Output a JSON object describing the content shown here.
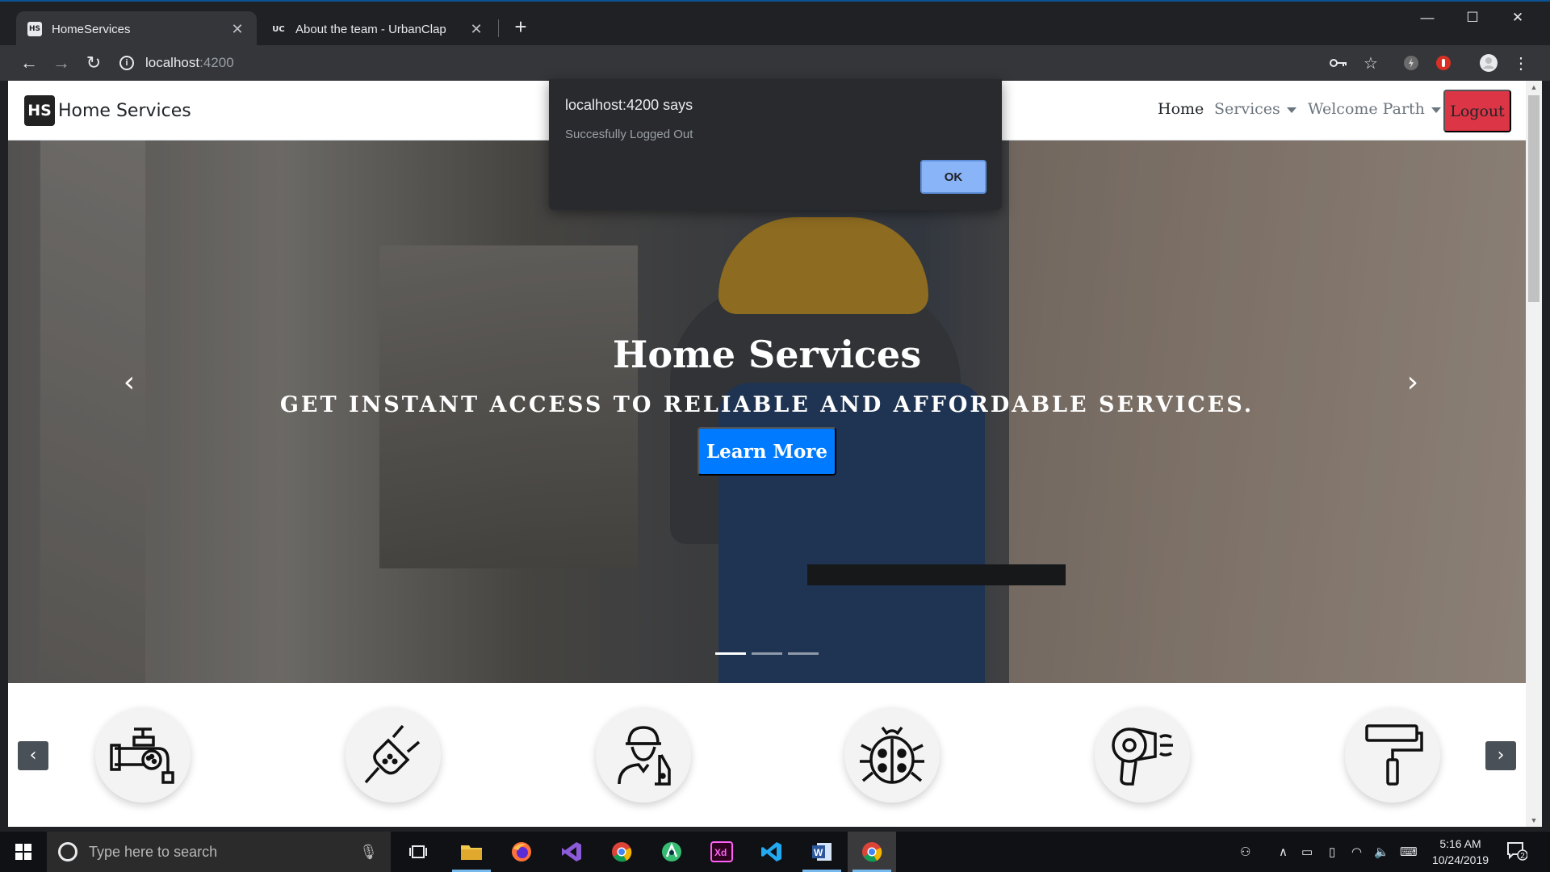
{
  "browser": {
    "tabs": [
      {
        "favicon": "HS",
        "title": "HomeServices",
        "active": true
      },
      {
        "favicon": "UC",
        "title": "About the team - UrbanClap",
        "active": false
      }
    ],
    "new_tab_label": "+",
    "address": {
      "host": "localhost",
      "port": ":4200"
    }
  },
  "dialog": {
    "title": "localhost:4200 says",
    "message": "Succesfully Logged Out",
    "ok_label": "OK"
  },
  "navbar": {
    "brand_logo": "HS",
    "brand_name": "Home Services",
    "links": [
      {
        "label": "Home",
        "active": true,
        "dropdown": false
      },
      {
        "label": "Services",
        "active": false,
        "dropdown": true
      },
      {
        "label": "Welcome Parth",
        "active": false,
        "dropdown": true
      }
    ],
    "logout_label": "Logout",
    "logout_color": "#dc3545"
  },
  "carousel": {
    "title": "Home Services",
    "subtitle": "GET INSTANT ACCESS TO RELIABLE AND AFFORDABLE SERVICES.",
    "cta_label": "Learn More",
    "cta_color": "#007bff",
    "prev_icon": "chevron-left-icon",
    "next_icon": "chevron-right-icon",
    "slide_count": 3,
    "active_slide": 0
  },
  "services": {
    "icons": [
      "plumbing-faucet-icon",
      "electric-plug-icon",
      "worker-tools-icon",
      "ladybug-pest-control-icon",
      "hair-dryer-icon",
      "paint-roller-icon"
    ],
    "prev_icon": "chevron-left-icon",
    "next_icon": "chevron-right-icon"
  },
  "taskbar": {
    "search_placeholder": "Type here to search",
    "apps": [
      "file-explorer-icon",
      "firefox-icon",
      "visual-studio-icon",
      "chrome-icon",
      "android-studio-icon",
      "adobe-xd-icon",
      "vscode-icon",
      "word-icon",
      "chrome-icon"
    ],
    "time": "5:16 AM",
    "date": "10/24/2019",
    "notification_count": "2"
  }
}
